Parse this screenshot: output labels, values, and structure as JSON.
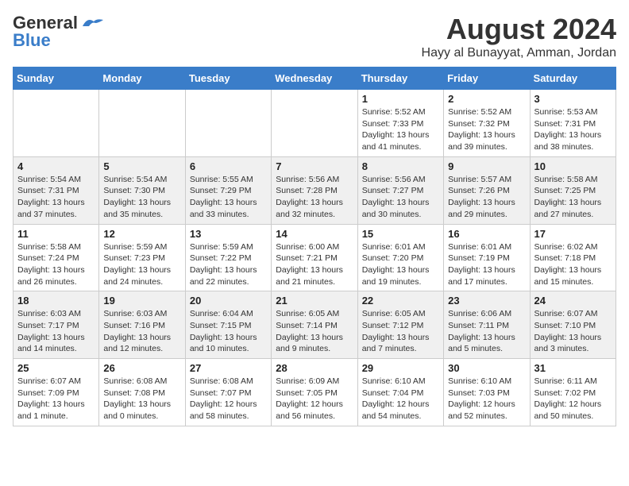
{
  "header": {
    "logo_line1": "General",
    "logo_line2": "Blue",
    "title": "August 2024",
    "subtitle": "Hayy al Bunayyat, Amman, Jordan"
  },
  "weekdays": [
    "Sunday",
    "Monday",
    "Tuesday",
    "Wednesday",
    "Thursday",
    "Friday",
    "Saturday"
  ],
  "weeks": [
    [
      {
        "day": "",
        "detail": ""
      },
      {
        "day": "",
        "detail": ""
      },
      {
        "day": "",
        "detail": ""
      },
      {
        "day": "",
        "detail": ""
      },
      {
        "day": "1",
        "detail": "Sunrise: 5:52 AM\nSunset: 7:33 PM\nDaylight: 13 hours\nand 41 minutes."
      },
      {
        "day": "2",
        "detail": "Sunrise: 5:52 AM\nSunset: 7:32 PM\nDaylight: 13 hours\nand 39 minutes."
      },
      {
        "day": "3",
        "detail": "Sunrise: 5:53 AM\nSunset: 7:31 PM\nDaylight: 13 hours\nand 38 minutes."
      }
    ],
    [
      {
        "day": "4",
        "detail": "Sunrise: 5:54 AM\nSunset: 7:31 PM\nDaylight: 13 hours\nand 37 minutes."
      },
      {
        "day": "5",
        "detail": "Sunrise: 5:54 AM\nSunset: 7:30 PM\nDaylight: 13 hours\nand 35 minutes."
      },
      {
        "day": "6",
        "detail": "Sunrise: 5:55 AM\nSunset: 7:29 PM\nDaylight: 13 hours\nand 33 minutes."
      },
      {
        "day": "7",
        "detail": "Sunrise: 5:56 AM\nSunset: 7:28 PM\nDaylight: 13 hours\nand 32 minutes."
      },
      {
        "day": "8",
        "detail": "Sunrise: 5:56 AM\nSunset: 7:27 PM\nDaylight: 13 hours\nand 30 minutes."
      },
      {
        "day": "9",
        "detail": "Sunrise: 5:57 AM\nSunset: 7:26 PM\nDaylight: 13 hours\nand 29 minutes."
      },
      {
        "day": "10",
        "detail": "Sunrise: 5:58 AM\nSunset: 7:25 PM\nDaylight: 13 hours\nand 27 minutes."
      }
    ],
    [
      {
        "day": "11",
        "detail": "Sunrise: 5:58 AM\nSunset: 7:24 PM\nDaylight: 13 hours\nand 26 minutes."
      },
      {
        "day": "12",
        "detail": "Sunrise: 5:59 AM\nSunset: 7:23 PM\nDaylight: 13 hours\nand 24 minutes."
      },
      {
        "day": "13",
        "detail": "Sunrise: 5:59 AM\nSunset: 7:22 PM\nDaylight: 13 hours\nand 22 minutes."
      },
      {
        "day": "14",
        "detail": "Sunrise: 6:00 AM\nSunset: 7:21 PM\nDaylight: 13 hours\nand 21 minutes."
      },
      {
        "day": "15",
        "detail": "Sunrise: 6:01 AM\nSunset: 7:20 PM\nDaylight: 13 hours\nand 19 minutes."
      },
      {
        "day": "16",
        "detail": "Sunrise: 6:01 AM\nSunset: 7:19 PM\nDaylight: 13 hours\nand 17 minutes."
      },
      {
        "day": "17",
        "detail": "Sunrise: 6:02 AM\nSunset: 7:18 PM\nDaylight: 13 hours\nand 15 minutes."
      }
    ],
    [
      {
        "day": "18",
        "detail": "Sunrise: 6:03 AM\nSunset: 7:17 PM\nDaylight: 13 hours\nand 14 minutes."
      },
      {
        "day": "19",
        "detail": "Sunrise: 6:03 AM\nSunset: 7:16 PM\nDaylight: 13 hours\nand 12 minutes."
      },
      {
        "day": "20",
        "detail": "Sunrise: 6:04 AM\nSunset: 7:15 PM\nDaylight: 13 hours\nand 10 minutes."
      },
      {
        "day": "21",
        "detail": "Sunrise: 6:05 AM\nSunset: 7:14 PM\nDaylight: 13 hours\nand 9 minutes."
      },
      {
        "day": "22",
        "detail": "Sunrise: 6:05 AM\nSunset: 7:12 PM\nDaylight: 13 hours\nand 7 minutes."
      },
      {
        "day": "23",
        "detail": "Sunrise: 6:06 AM\nSunset: 7:11 PM\nDaylight: 13 hours\nand 5 minutes."
      },
      {
        "day": "24",
        "detail": "Sunrise: 6:07 AM\nSunset: 7:10 PM\nDaylight: 13 hours\nand 3 minutes."
      }
    ],
    [
      {
        "day": "25",
        "detail": "Sunrise: 6:07 AM\nSunset: 7:09 PM\nDaylight: 13 hours\nand 1 minute."
      },
      {
        "day": "26",
        "detail": "Sunrise: 6:08 AM\nSunset: 7:08 PM\nDaylight: 13 hours\nand 0 minutes."
      },
      {
        "day": "27",
        "detail": "Sunrise: 6:08 AM\nSunset: 7:07 PM\nDaylight: 12 hours\nand 58 minutes."
      },
      {
        "day": "28",
        "detail": "Sunrise: 6:09 AM\nSunset: 7:05 PM\nDaylight: 12 hours\nand 56 minutes."
      },
      {
        "day": "29",
        "detail": "Sunrise: 6:10 AM\nSunset: 7:04 PM\nDaylight: 12 hours\nand 54 minutes."
      },
      {
        "day": "30",
        "detail": "Sunrise: 6:10 AM\nSunset: 7:03 PM\nDaylight: 12 hours\nand 52 minutes."
      },
      {
        "day": "31",
        "detail": "Sunrise: 6:11 AM\nSunset: 7:02 PM\nDaylight: 12 hours\nand 50 minutes."
      }
    ]
  ]
}
